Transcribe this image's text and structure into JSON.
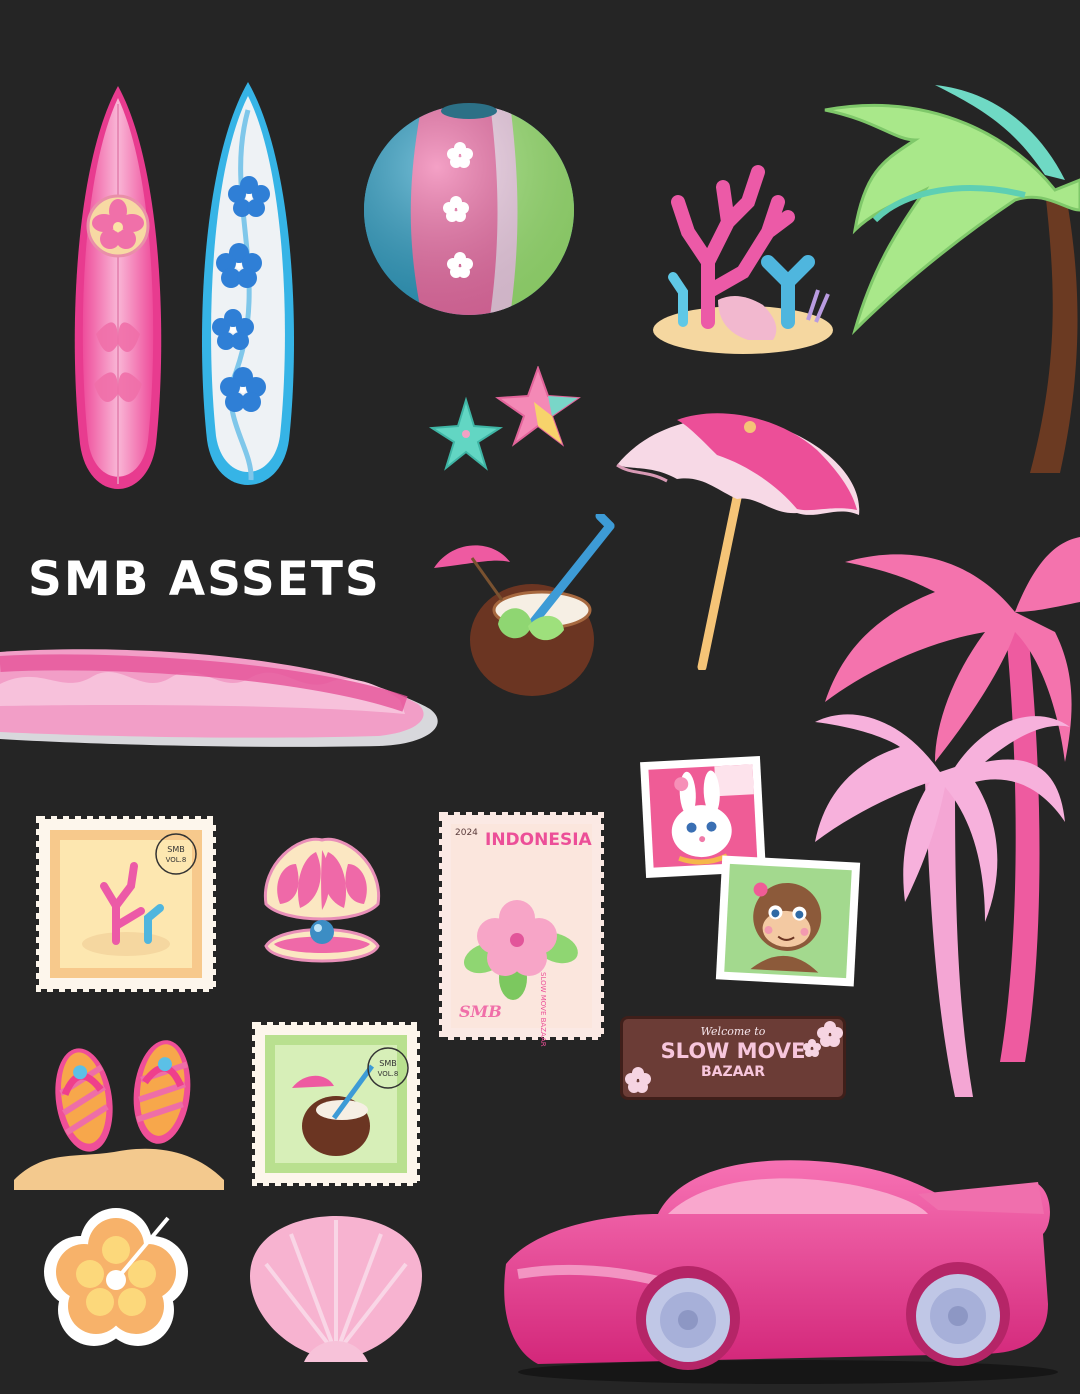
{
  "title": "SMB ASSETS",
  "stamp_indonesia": {
    "year": "2024",
    "country": "INDONESIA",
    "side_text": "SLOW MOVE BAZAAR",
    "mark": "SMB"
  },
  "postmark": {
    "line1": "SMB",
    "line2": "VOL.8"
  },
  "sign": {
    "welcome": "Welcome to",
    "name": "SLOW MOVE",
    "sub": "BAZAAR"
  },
  "assets": [
    "pink-surfboard",
    "blue-surfboard",
    "beach-ball",
    "coral-reef",
    "green-palm-tree",
    "starfish-pair",
    "beach-umbrella",
    "coconut-drink",
    "long-surfboard",
    "pink-palm-trees",
    "coral-stamp",
    "pearl-shell",
    "indonesia-stamp",
    "bunny-photo",
    "monkey-photo",
    "welcome-sign",
    "flip-flops",
    "coconut-stamp",
    "hibiscus-sticker",
    "scallop-shell",
    "pink-sports-car"
  ],
  "colors": {
    "background": "#252525",
    "pink": "#ef5fa6",
    "light_pink": "#f7b2d4",
    "blue": "#3aa7e0",
    "green": "#9de07a",
    "cream": "#fbf0d6",
    "brown": "#5b2d24"
  }
}
